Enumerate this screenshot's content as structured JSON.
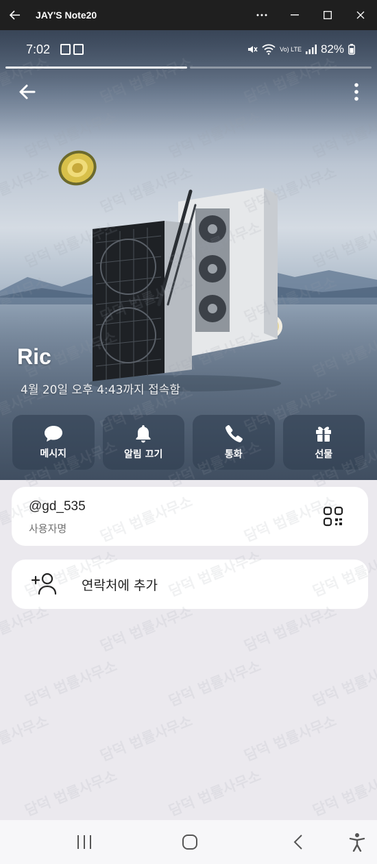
{
  "window": {
    "title": "JAY'S Note20"
  },
  "status_bar": {
    "time": "7:02",
    "network": "Vo) LTE",
    "battery": "82%"
  },
  "profile": {
    "name": "Ric",
    "last_seen": "4월 20일 오후 4:43까지 접속함"
  },
  "actions": [
    {
      "label": "메시지",
      "icon": "chat-bubble-icon"
    },
    {
      "label": "알림 끄기",
      "icon": "bell-icon"
    },
    {
      "label": "통화",
      "icon": "phone-icon"
    },
    {
      "label": "선물",
      "icon": "gift-icon"
    }
  ],
  "user_card": {
    "username": "@gd_535",
    "label": "사용자명"
  },
  "add_contact": {
    "label": "연락처에 추가"
  },
  "watermark": {
    "text": "담덕 법률사무소"
  },
  "colors": {
    "background": "#ebe9ee",
    "titlebar": "#1f1f1f",
    "card": "#ffffff"
  }
}
